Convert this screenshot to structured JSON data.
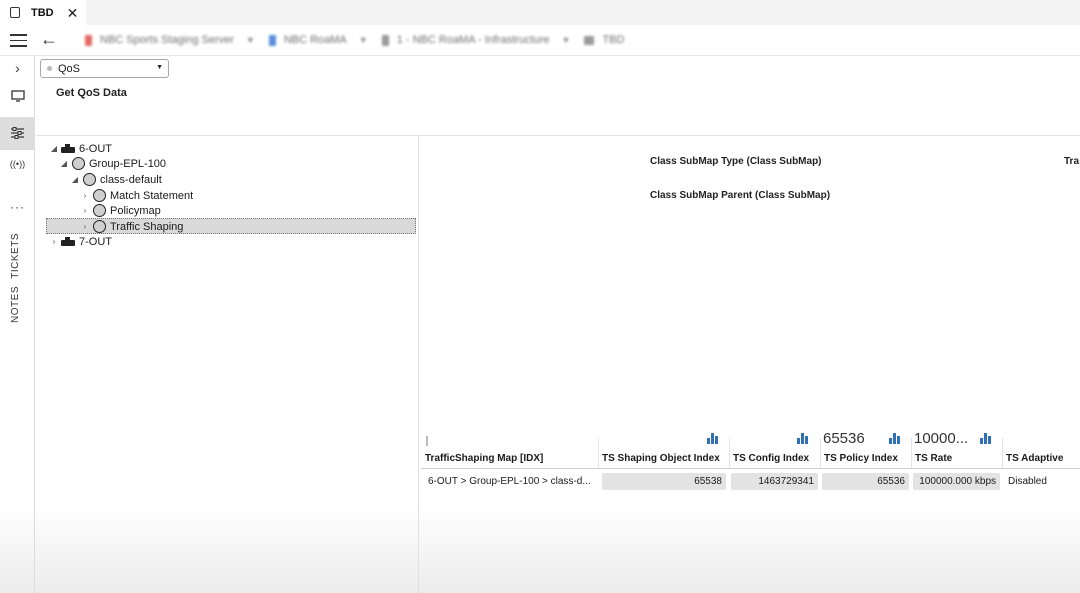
{
  "window": {
    "tab_title": "TBD",
    "close_glyph": "✕"
  },
  "nav": {
    "breadcrumbs": [
      {
        "label": "NBC Sports Staging Server",
        "color": "#e0504a"
      },
      {
        "label": "NBC RoaMA",
        "color": "#3a7bd5"
      },
      {
        "label": "1 - NBC RoaMA - Infrastructure",
        "color": "#888888"
      },
      {
        "label": "TBD",
        "color": "#888888"
      }
    ]
  },
  "rail": {
    "tickets_label": "TICKETS",
    "notes_label": "NOTES"
  },
  "toolbar": {
    "selector_value": "QoS",
    "get_data_label": "Get QoS Data"
  },
  "tree": {
    "nodes": [
      {
        "label": "6-OUT"
      },
      {
        "label": "Group-EPL-100"
      },
      {
        "label": "class-default"
      },
      {
        "label": "Match Statement"
      },
      {
        "label": "Policymap"
      },
      {
        "label": "Traffic Shaping"
      },
      {
        "label": "7-OUT"
      }
    ]
  },
  "detail": {
    "type_label": "Class SubMap Type (Class SubMap)",
    "parent_label": "Class SubMap Parent (Class SubMap)",
    "cut_label": "Tra"
  },
  "table": {
    "headers": [
      "TrafficShaping Map [IDX]",
      "TS Shaping Object Index",
      "TS Config Index",
      "TS Policy Index",
      "TS Rate",
      "TS Adaptive"
    ],
    "stats": [
      "65536",
      "10000..."
    ],
    "row": [
      "6-OUT > Group-EPL-100 > class-d...",
      "65538",
      "1463729341",
      "65536",
      "100000.000 kbps",
      "Disabled"
    ]
  }
}
